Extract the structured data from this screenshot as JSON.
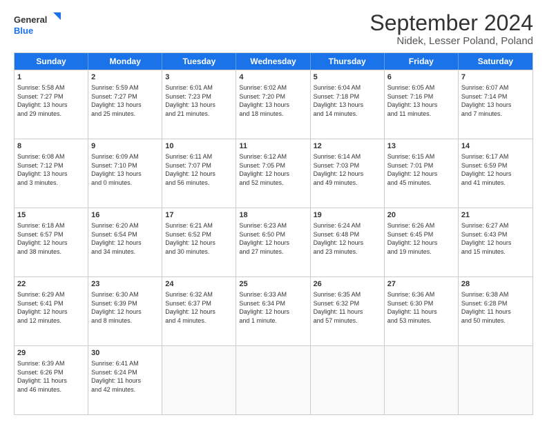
{
  "logo": {
    "text_general": "General",
    "text_blue": "Blue"
  },
  "title": "September 2024",
  "subtitle": "Nidek, Lesser Poland, Poland",
  "headers": [
    "Sunday",
    "Monday",
    "Tuesday",
    "Wednesday",
    "Thursday",
    "Friday",
    "Saturday"
  ],
  "rows": [
    [
      {
        "day": "",
        "text": "",
        "empty": true
      },
      {
        "day": "",
        "text": "",
        "empty": true
      },
      {
        "day": "",
        "text": "",
        "empty": true
      },
      {
        "day": "",
        "text": "",
        "empty": true
      },
      {
        "day": "",
        "text": "",
        "empty": true
      },
      {
        "day": "",
        "text": "",
        "empty": true
      },
      {
        "day": "",
        "text": "",
        "empty": true
      }
    ],
    [
      {
        "day": "1",
        "text": "Sunrise: 5:58 AM\nSunset: 7:27 PM\nDaylight: 13 hours\nand 29 minutes.",
        "empty": false
      },
      {
        "day": "2",
        "text": "Sunrise: 5:59 AM\nSunset: 7:27 PM\nDaylight: 13 hours\nand 25 minutes.",
        "empty": false
      },
      {
        "day": "3",
        "text": "Sunrise: 6:01 AM\nSunset: 7:23 PM\nDaylight: 13 hours\nand 21 minutes.",
        "empty": false
      },
      {
        "day": "4",
        "text": "Sunrise: 6:02 AM\nSunset: 7:20 PM\nDaylight: 13 hours\nand 18 minutes.",
        "empty": false
      },
      {
        "day": "5",
        "text": "Sunrise: 6:04 AM\nSunset: 7:18 PM\nDaylight: 13 hours\nand 14 minutes.",
        "empty": false
      },
      {
        "day": "6",
        "text": "Sunrise: 6:05 AM\nSunset: 7:16 PM\nDaylight: 13 hours\nand 11 minutes.",
        "empty": false
      },
      {
        "day": "7",
        "text": "Sunrise: 6:07 AM\nSunset: 7:14 PM\nDaylight: 13 hours\nand 7 minutes.",
        "empty": false
      }
    ],
    [
      {
        "day": "8",
        "text": "Sunrise: 6:08 AM\nSunset: 7:12 PM\nDaylight: 13 hours\nand 3 minutes.",
        "empty": false
      },
      {
        "day": "9",
        "text": "Sunrise: 6:09 AM\nSunset: 7:10 PM\nDaylight: 13 hours\nand 0 minutes.",
        "empty": false
      },
      {
        "day": "10",
        "text": "Sunrise: 6:11 AM\nSunset: 7:07 PM\nDaylight: 12 hours\nand 56 minutes.",
        "empty": false
      },
      {
        "day": "11",
        "text": "Sunrise: 6:12 AM\nSunset: 7:05 PM\nDaylight: 12 hours\nand 52 minutes.",
        "empty": false
      },
      {
        "day": "12",
        "text": "Sunrise: 6:14 AM\nSunset: 7:03 PM\nDaylight: 12 hours\nand 49 minutes.",
        "empty": false
      },
      {
        "day": "13",
        "text": "Sunrise: 6:15 AM\nSunset: 7:01 PM\nDaylight: 12 hours\nand 45 minutes.",
        "empty": false
      },
      {
        "day": "14",
        "text": "Sunrise: 6:17 AM\nSunset: 6:59 PM\nDaylight: 12 hours\nand 41 minutes.",
        "empty": false
      }
    ],
    [
      {
        "day": "15",
        "text": "Sunrise: 6:18 AM\nSunset: 6:57 PM\nDaylight: 12 hours\nand 38 minutes.",
        "empty": false
      },
      {
        "day": "16",
        "text": "Sunrise: 6:20 AM\nSunset: 6:54 PM\nDaylight: 12 hours\nand 34 minutes.",
        "empty": false
      },
      {
        "day": "17",
        "text": "Sunrise: 6:21 AM\nSunset: 6:52 PM\nDaylight: 12 hours\nand 30 minutes.",
        "empty": false
      },
      {
        "day": "18",
        "text": "Sunrise: 6:23 AM\nSunset: 6:50 PM\nDaylight: 12 hours\nand 27 minutes.",
        "empty": false
      },
      {
        "day": "19",
        "text": "Sunrise: 6:24 AM\nSunset: 6:48 PM\nDaylight: 12 hours\nand 23 minutes.",
        "empty": false
      },
      {
        "day": "20",
        "text": "Sunrise: 6:26 AM\nSunset: 6:45 PM\nDaylight: 12 hours\nand 19 minutes.",
        "empty": false
      },
      {
        "day": "21",
        "text": "Sunrise: 6:27 AM\nSunset: 6:43 PM\nDaylight: 12 hours\nand 15 minutes.",
        "empty": false
      }
    ],
    [
      {
        "day": "22",
        "text": "Sunrise: 6:29 AM\nSunset: 6:41 PM\nDaylight: 12 hours\nand 12 minutes.",
        "empty": false
      },
      {
        "day": "23",
        "text": "Sunrise: 6:30 AM\nSunset: 6:39 PM\nDaylight: 12 hours\nand 8 minutes.",
        "empty": false
      },
      {
        "day": "24",
        "text": "Sunrise: 6:32 AM\nSunset: 6:37 PM\nDaylight: 12 hours\nand 4 minutes.",
        "empty": false
      },
      {
        "day": "25",
        "text": "Sunrise: 6:33 AM\nSunset: 6:34 PM\nDaylight: 12 hours\nand 1 minute.",
        "empty": false
      },
      {
        "day": "26",
        "text": "Sunrise: 6:35 AM\nSunset: 6:32 PM\nDaylight: 11 hours\nand 57 minutes.",
        "empty": false
      },
      {
        "day": "27",
        "text": "Sunrise: 6:36 AM\nSunset: 6:30 PM\nDaylight: 11 hours\nand 53 minutes.",
        "empty": false
      },
      {
        "day": "28",
        "text": "Sunrise: 6:38 AM\nSunset: 6:28 PM\nDaylight: 11 hours\nand 50 minutes.",
        "empty": false
      }
    ],
    [
      {
        "day": "29",
        "text": "Sunrise: 6:39 AM\nSunset: 6:26 PM\nDaylight: 11 hours\nand 46 minutes.",
        "empty": false
      },
      {
        "day": "30",
        "text": "Sunrise: 6:41 AM\nSunset: 6:24 PM\nDaylight: 11 hours\nand 42 minutes.",
        "empty": false
      },
      {
        "day": "",
        "text": "",
        "empty": true
      },
      {
        "day": "",
        "text": "",
        "empty": true
      },
      {
        "day": "",
        "text": "",
        "empty": true
      },
      {
        "day": "",
        "text": "",
        "empty": true
      },
      {
        "day": "",
        "text": "",
        "empty": true
      }
    ]
  ]
}
